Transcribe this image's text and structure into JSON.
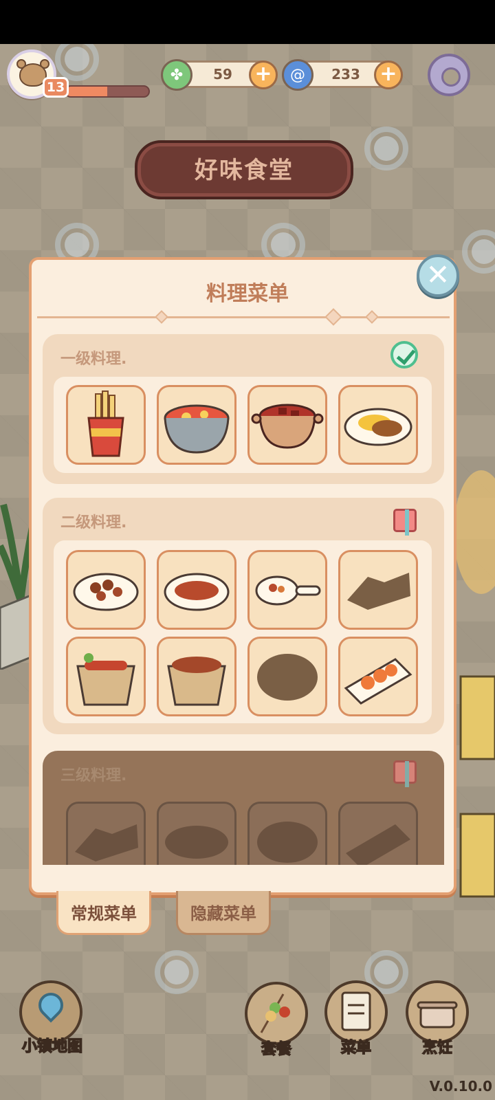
{
  "hud": {
    "level": "13",
    "xp_progress": 0.5,
    "currency_green": "59",
    "currency_blue": "233",
    "plus_symbol": "+"
  },
  "restaurant": {
    "name": "好味食堂"
  },
  "panel": {
    "title": "料理菜单",
    "close_symbol": "✕",
    "sections": [
      {
        "label": "一级料理.",
        "status": "completed",
        "status_icon": "check-icon",
        "dishes": [
          "fries",
          "tomato-egg-bowl",
          "braised-meat-pot",
          "curry-rice"
        ],
        "locked": [
          false,
          false,
          false,
          false
        ]
      },
      {
        "label": "二级料理.",
        "status": "reward",
        "status_icon": "gift-icon",
        "dishes": [
          "stir-fried-meat",
          "braised-pork-plate",
          "meat-pan",
          "unknown-dish",
          "sausage-steamer",
          "meat-steamer",
          "unknown-pot",
          "shrimp-balls-plate"
        ],
        "locked": [
          false,
          false,
          false,
          true,
          false,
          false,
          true,
          false
        ]
      },
      {
        "label": "三级料理.",
        "status": "locked-reward",
        "status_icon": "gift-icon",
        "dishes": [
          "unknown-dish",
          "unknown-plate",
          "unknown-pot",
          "unknown-skewer"
        ],
        "locked": [
          true,
          true,
          true,
          true
        ]
      }
    ]
  },
  "tabs": {
    "regular": "常规菜单",
    "hidden": "隐藏菜单"
  },
  "bottom": {
    "map": "小镇地图",
    "combo": "套餐",
    "menu": "菜单",
    "cook": "烹饪",
    "version": "V.0.10.0"
  },
  "colors": {
    "accent": "#e3a072",
    "title_text": "#c07d59",
    "board": "#6d3a33"
  }
}
